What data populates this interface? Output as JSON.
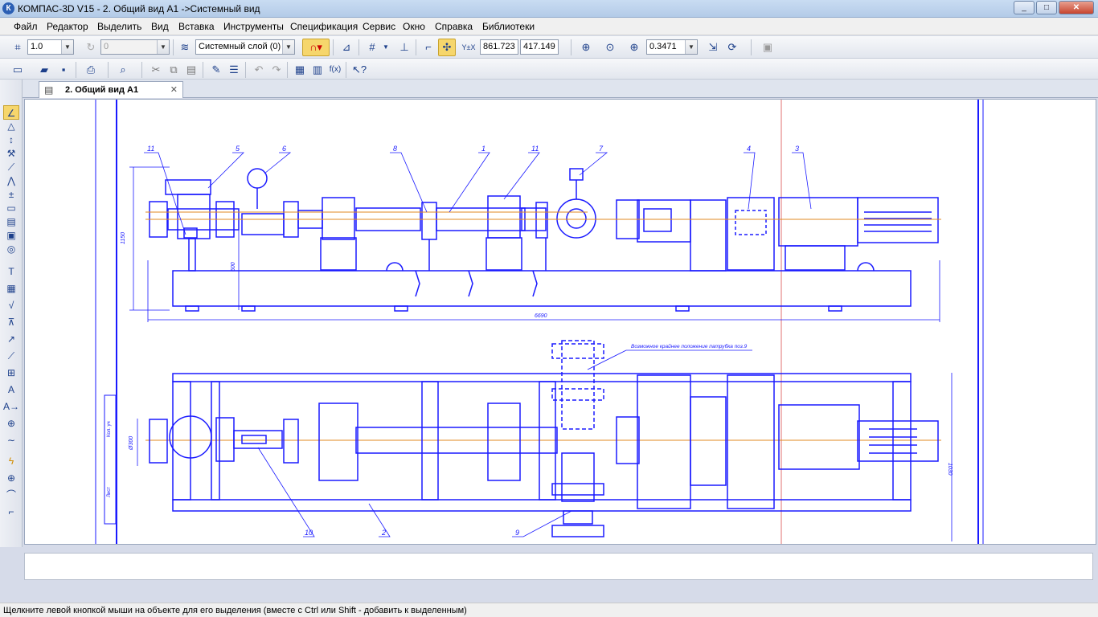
{
  "window": {
    "title": "КОМПАС-3D V15 - 2. Общий вид А1 ->Системный вид",
    "app_icon": "К",
    "controls": [
      "_",
      "□",
      "✕"
    ]
  },
  "menu": [
    "Файл",
    "Редактор",
    "Выделить",
    "Вид",
    "Вставка",
    "Инструменты",
    "Спецификация",
    "Сервис",
    "Окно",
    "Справка",
    "Библиотеки"
  ],
  "toolbar": {
    "step_value": "1.0",
    "angle_value": "0",
    "layer_value": "Системный слой (0)",
    "coord_x": "861.723",
    "coord_y": "417.149",
    "coord_label": "Y±X",
    "zoom_value": "0.3471",
    "fx_label": "f(x)"
  },
  "document_tab": {
    "label": "2. Общий вид А1"
  },
  "drawing": {
    "callouts": [
      "11",
      "5",
      "6",
      "8",
      "1",
      "11",
      "7",
      "4",
      "3",
      "2",
      "9",
      "10"
    ],
    "dim_total_length": "6690",
    "dim_height_left": "1150",
    "dim_height_inner": "600",
    "dim_width_right": "1030",
    "dim_left_plan": "Ø300",
    "note_text": "Возможное крайнее положение патрубка поз.9",
    "frame_label_top": "Кол. уч",
    "frame_label_bottom": "Лист"
  },
  "status": {
    "hint": "Щелкните левой кнопкой мыши на объекте для его выделения (вместе с Ctrl или Shift - добавить к выделенным)"
  }
}
